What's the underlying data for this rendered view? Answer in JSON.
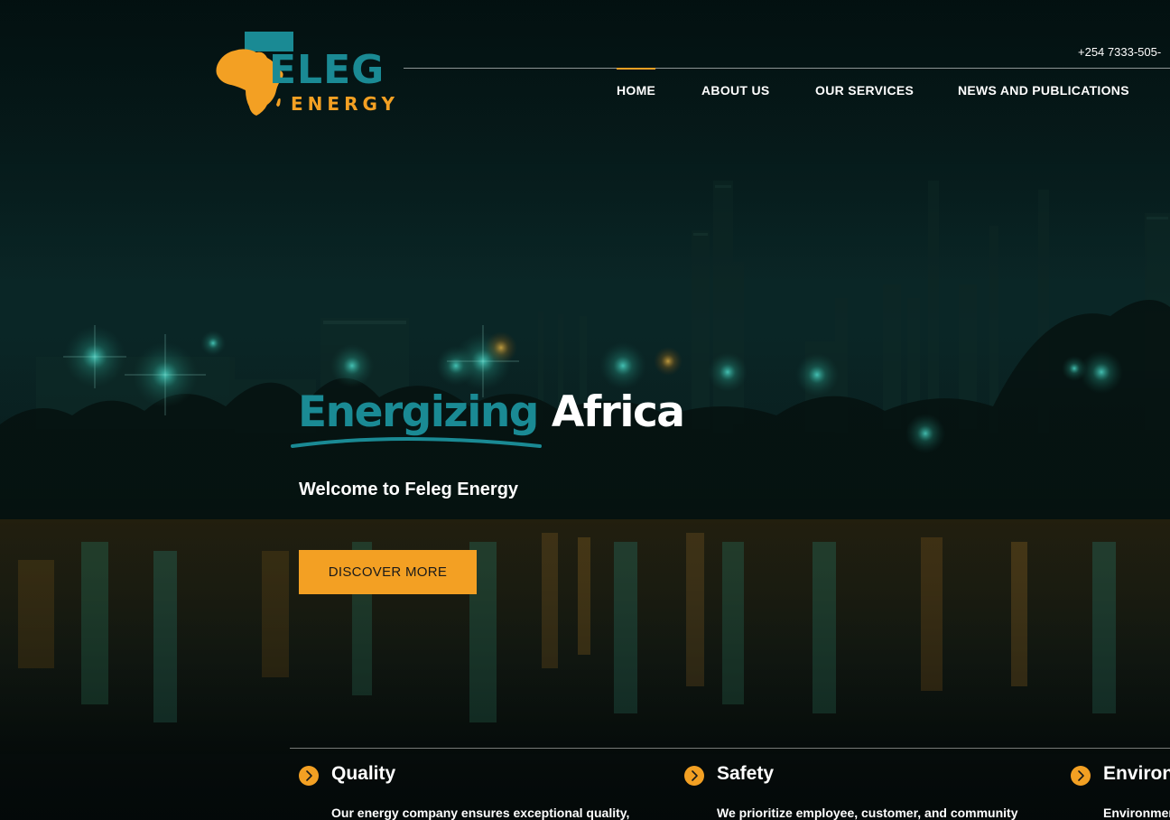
{
  "header": {
    "phone": "+254 7333-505-",
    "logo": {
      "wordmark": "ELEG",
      "subtitle": "ENERGY"
    },
    "nav": [
      {
        "label": "HOME",
        "active": true
      },
      {
        "label": "ABOUT US",
        "active": false
      },
      {
        "label": "OUR SERVICES",
        "active": false
      },
      {
        "label": "NEWS AND PUBLICATIONS",
        "active": false
      }
    ]
  },
  "hero": {
    "title_accent": "Energizing",
    "title_rest": "Africa",
    "subtitle": "Welcome to Feleg Energy",
    "cta_label": "DISCOVER MORE"
  },
  "features": [
    {
      "title": "Quality",
      "description": "Our energy company ensures exceptional quality,"
    },
    {
      "title": "Safety",
      "description": "We prioritize employee, customer, and community"
    },
    {
      "title": "Environ",
      "description": "Environmer"
    }
  ],
  "colors": {
    "brand_teal": "#1a8a94",
    "brand_orange": "#f3a023",
    "text": "#ffffff"
  },
  "icons": {
    "feature": "chevron-right-circle-icon"
  }
}
